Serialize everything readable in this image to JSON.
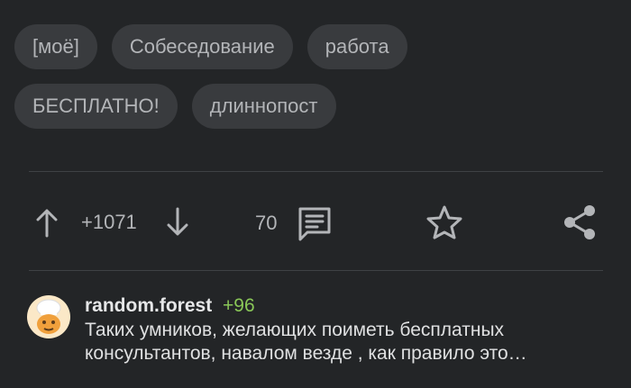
{
  "tags": {
    "row1": [
      "[моё]",
      "Собеседование",
      "работа"
    ],
    "row2": [
      "БЕСПЛАТНО!",
      "длиннопост"
    ]
  },
  "actions": {
    "rating": "+1071",
    "comments_count": "70",
    "icons": [
      "arrow-up-icon",
      "arrow-down-icon",
      "comment-icon",
      "star-icon",
      "share-icon"
    ]
  },
  "comment": {
    "author": "random.forest",
    "rating": "+96",
    "text_line1": "Таких умников, желающих поиметь бесплатных",
    "text_line2": "консультантов, навалом везде , как правило это…"
  },
  "colors": {
    "background": "#232527",
    "tag_bg": "#393b3e",
    "muted_text": "#b3b5b8",
    "positive": "#8ac858"
  }
}
